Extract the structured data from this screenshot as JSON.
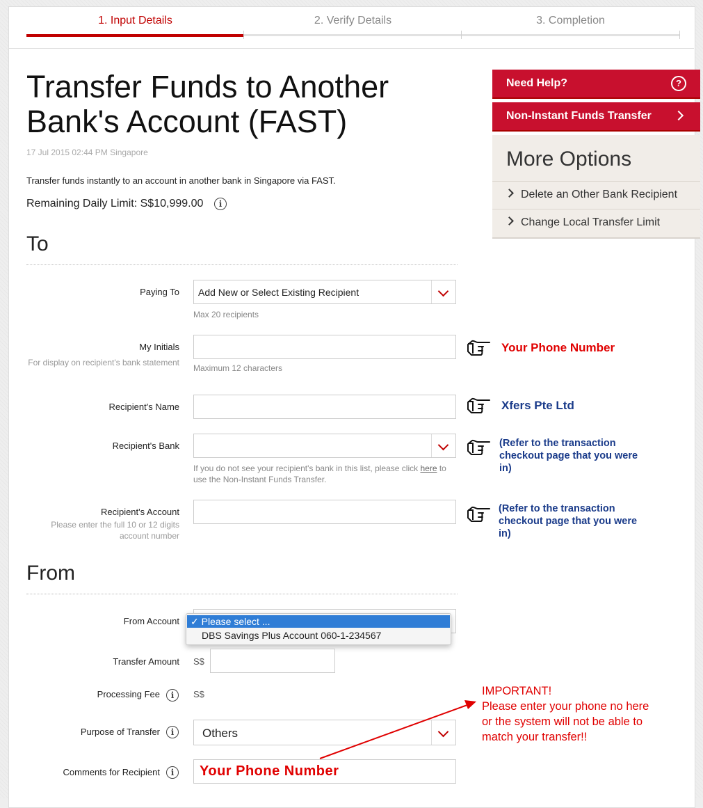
{
  "steps": [
    "1. Input Details",
    "2. Verify Details",
    "3. Completion"
  ],
  "page": {
    "title": "Transfer Funds to Another Bank's Account (FAST)",
    "timestamp": "17 Jul 2015 02:44 PM Singapore",
    "description": "Transfer funds instantly to an account in another bank in Singapore via FAST.",
    "limit_label": "Remaining Daily Limit:",
    "limit_value": "S$10,999.00"
  },
  "sidebar": {
    "help_label": "Need Help?",
    "non_instant_label": "Non-Instant Funds Transfer",
    "more_title": "More Options",
    "options": [
      "Delete an Other Bank Recipient",
      "Change Local Transfer Limit"
    ]
  },
  "to": {
    "title": "To",
    "paying_to": {
      "label": "Paying To",
      "value": "Add New or Select Existing Recipient",
      "help": "Max 20 recipients"
    },
    "initials": {
      "label": "My Initials",
      "sublabel": "For display on recipient's bank statement",
      "help": "Maximum 12 characters"
    },
    "recipient_name": {
      "label": "Recipient's Name"
    },
    "recipient_bank": {
      "label": "Recipient's Bank",
      "help_before": "If you do not see your recipient's bank in this list, please click",
      "help_link": "here",
      "help_after": "to use the Non-Instant Funds Transfer."
    },
    "recipient_account": {
      "label": "Recipient's Account",
      "sublabel": "Please enter the full 10 or 12 digits account number"
    }
  },
  "from": {
    "title": "From",
    "from_account": {
      "label": "From Account",
      "options": [
        "Please select ...",
        "DBS Savings Plus Account 060-1-234567"
      ]
    },
    "amount": {
      "label": "Transfer Amount",
      "currency": "S$"
    },
    "fee": {
      "label": "Processing Fee",
      "currency": "S$"
    },
    "purpose": {
      "label": "Purpose of Transfer",
      "value": "Others"
    },
    "comments": {
      "label": "Comments for Recipient",
      "value": "Your Phone Number"
    }
  },
  "notes": {
    "phone": "Your Phone Number",
    "xfers": "Xfers Pte Ltd",
    "refer": "(Refer to the transaction checkout page that you were in)",
    "important": [
      "IMPORTANT!",
      "Please enter your phone no here",
      "or the system will not be able to",
      "match your transfer!!"
    ]
  },
  "colors": {
    "brand_red": "#c8102e",
    "note_red": "#e00000",
    "note_blue": "#1a3b8a"
  }
}
